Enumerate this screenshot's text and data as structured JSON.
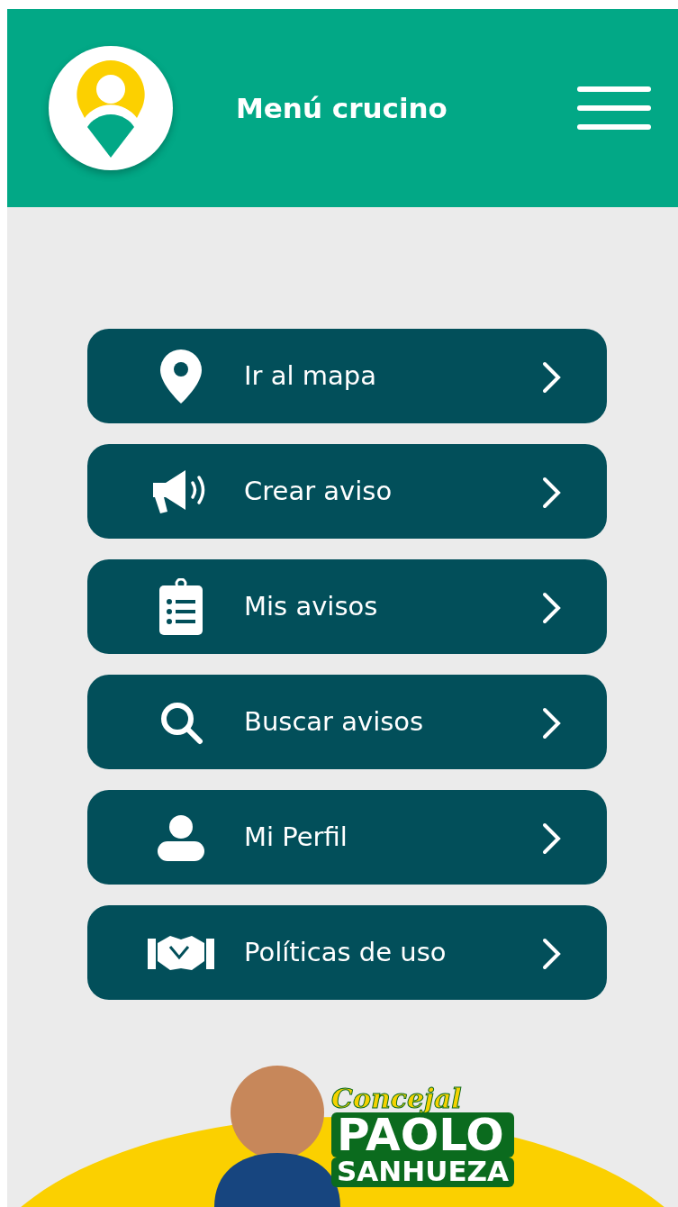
{
  "header": {
    "title": "Menú crucino"
  },
  "menu": [
    {
      "label": "Ir al mapa"
    },
    {
      "label": "Crear aviso"
    },
    {
      "label": "Mis avisos"
    },
    {
      "label": "Buscar avisos"
    },
    {
      "label": "Mi Perfil"
    },
    {
      "label": "Políticas de uso"
    }
  ],
  "banner": {
    "line_1": "Concejal",
    "line_2": "PAOLO",
    "line_3": "SANHUEZA"
  }
}
